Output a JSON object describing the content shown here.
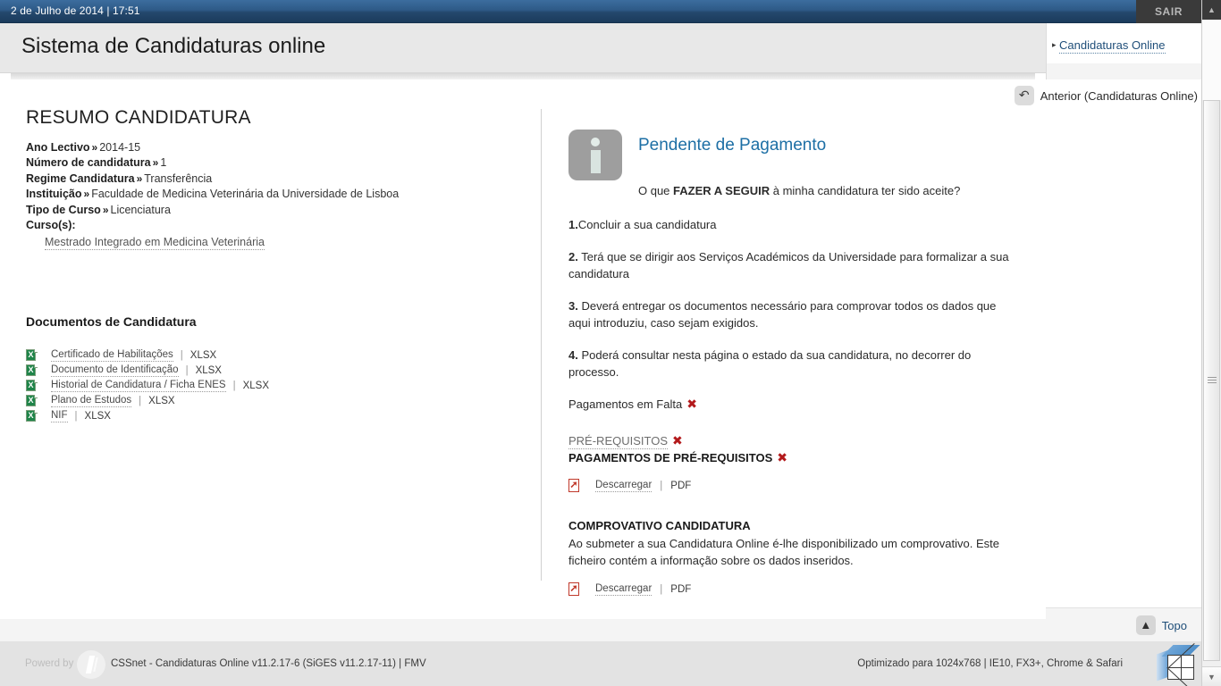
{
  "topbar": {
    "datetime": "2 de Julho de 2014 | 17:51",
    "logout_label": "SAIR"
  },
  "header": {
    "site_title": "Sistema de Candidaturas online"
  },
  "right_nav": {
    "arrow": "▸",
    "link_label": "Candidaturas Online"
  },
  "back_link": {
    "icon": "↶",
    "label": "Anterior (Candidaturas Online)"
  },
  "summary": {
    "title": "RESUMO CANDIDATURA",
    "separator": "»",
    "fields": [
      {
        "label": "Ano Lectivo",
        "value": "2014-15"
      },
      {
        "label": "Número de candidatura",
        "value": "1"
      },
      {
        "label": "Regime Candidatura",
        "value": "Transferência"
      },
      {
        "label": "Instituição",
        "value": "Faculdade de Medicina Veterinária da Universidade de Lisboa"
      },
      {
        "label": "Tipo de Curso",
        "value": "Licenciatura"
      }
    ],
    "courses_label": "Curso(s):",
    "course_link": "Mestrado Integrado em Medicina Veterinária"
  },
  "documents": {
    "title": "Documentos de Candidatura",
    "items": [
      {
        "name": "Certificado de Habilitações",
        "ext": "XLSX",
        "icon": "xlsx-file-icon"
      },
      {
        "name": "Documento de Identificação",
        "ext": "XLSX",
        "icon": "xlsx-file-icon"
      },
      {
        "name": "Historial de Candidatura / Ficha ENES",
        "ext": "XLSX",
        "icon": "xlsx-file-icon"
      },
      {
        "name": "Plano de Estudos",
        "ext": "XLSX",
        "icon": "xlsx-file-icon"
      },
      {
        "name": "NIF",
        "ext": "XLSX",
        "icon": "xlsx-file-icon"
      }
    ],
    "separator": "|"
  },
  "status": {
    "icon": "info-icon",
    "title": "Pendente de Pagamento",
    "title_color": "#1d6fa5",
    "question_prefix": "O que ",
    "question_bold": "FAZER A SEGUIR",
    "question_suffix": " à minha candidatura ter sido aceite?",
    "steps": [
      {
        "num": "1.",
        "text": "Concluir a sua candidatura"
      },
      {
        "num": "2.",
        "text": " Terá que se dirigir aos Serviços Académicos da Universidade para formalizar a sua candidatura"
      },
      {
        "num": "3.",
        "text": " Deverá entregar os documentos necessário para comprovar todos os dados que aqui introduziu, caso sejam exigidos."
      },
      {
        "num": "4.",
        "text": " Poderá consultar nesta página o estado da sua candidatura, no decorrer do processo."
      }
    ],
    "payments_missing": "Pagamentos em Falta",
    "x_mark": "✖",
    "x_color": "#b3191b",
    "prerequisites": "PRÉ-REQUISITOS",
    "prerequisites_payments": "PAGAMENTOS DE PRÉ-REQUISITOS",
    "download_1": {
      "label": "Descarregar",
      "ext": "PDF",
      "separator": "|",
      "icon": "pdf-file-icon"
    },
    "proof_title": "COMPROVATIVO CANDIDATURA",
    "proof_text": "Ao submeter a sua Candidatura Online é-lhe disponibilizado um comprovativo. Este ficheiro contém a informação sobre os dados inseridos.",
    "download_2": {
      "label": "Descarregar",
      "ext": "PDF",
      "separator": "|",
      "icon": "pdf-file-icon"
    }
  },
  "topo": {
    "icon": "▲",
    "label": "Topo"
  },
  "footer": {
    "powered_by": "Powerd by",
    "product": "CSSnet - Candidaturas Online v11.2.17-6 (SiGES v11.2.17-11) | FMV",
    "optimized": "Optimizado para 1024x768 | IE10, FX3+, Chrome & Safari"
  },
  "scrollbar": {
    "up_arrow": "▲",
    "down_arrow": "▼"
  }
}
